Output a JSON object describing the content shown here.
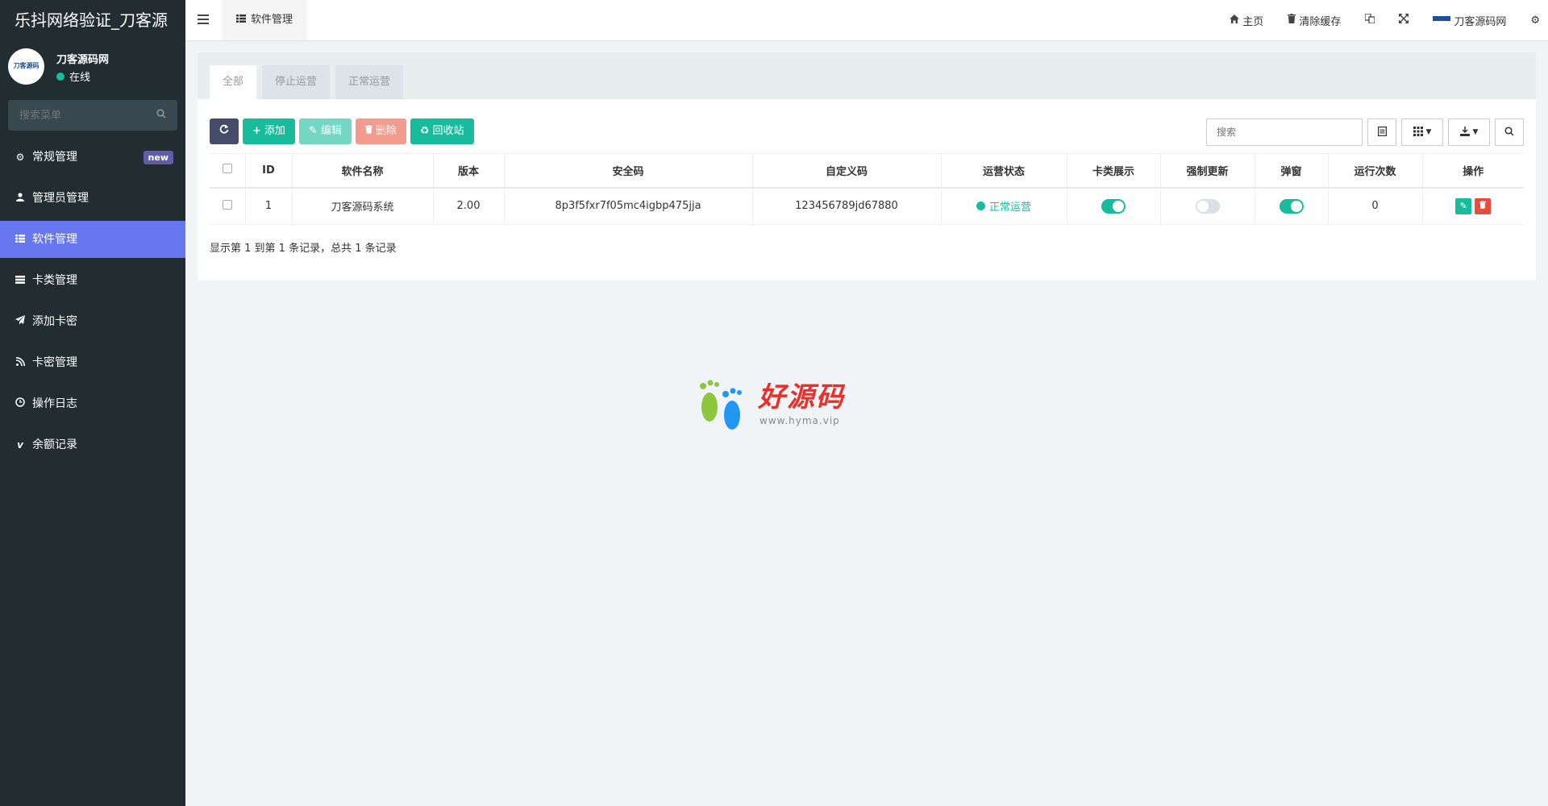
{
  "app": {
    "title": "乐抖网络验证_刀客源"
  },
  "user": {
    "name": "刀客源码网",
    "status": "在线",
    "avatar_text": "刀客源码"
  },
  "sidebar": {
    "search_placeholder": "搜索菜单",
    "items": [
      {
        "label": "常规管理",
        "icon": "cogs-icon",
        "badge": "new"
      },
      {
        "label": "管理员管理",
        "icon": "user-icon"
      },
      {
        "label": "软件管理",
        "icon": "list-icon",
        "active": true
      },
      {
        "label": "卡类管理",
        "icon": "server-icon"
      },
      {
        "label": "添加卡密",
        "icon": "paper-plane-icon"
      },
      {
        "label": "卡密管理",
        "icon": "rss-icon"
      },
      {
        "label": "操作日志",
        "icon": "clock-icon"
      },
      {
        "label": "余额记录",
        "icon": "vimeo-icon"
      }
    ]
  },
  "header": {
    "tab_label": "软件管理",
    "home": "主页",
    "clear_cache": "清除缓存",
    "site_name": "刀客源码网"
  },
  "content": {
    "tabs": [
      "全部",
      "停止运营",
      "正常运营"
    ],
    "toolbar": {
      "add": "添加",
      "edit": "编辑",
      "delete": "删除",
      "recycle": "回收站"
    },
    "search_placeholder": "搜索",
    "columns": [
      "ID",
      "软件名称",
      "版本",
      "安全码",
      "自定义码",
      "运营状态",
      "卡类展示",
      "强制更新",
      "弹窗",
      "运行次数",
      "操作"
    ],
    "rows": [
      {
        "id": "1",
        "name": "刀客源码系统",
        "version": "2.00",
        "secret": "8p3f5fxr7f05mc4igbp475jja",
        "custom": "123456789jd67880",
        "status": "正常运营",
        "card_show": true,
        "force_update": false,
        "popup": true,
        "runs": "0"
      }
    ],
    "pager": "显示第 1 到第 1 条记录，总共 1 条记录"
  },
  "watermark": {
    "text": "好源码",
    "url": "www.hyma.vip"
  },
  "colors": {
    "sidebar_bg": "#222d32",
    "active": "#6777ef",
    "green": "#18bc9c",
    "red": "#e74c3c",
    "dark_btn": "#444c69"
  }
}
